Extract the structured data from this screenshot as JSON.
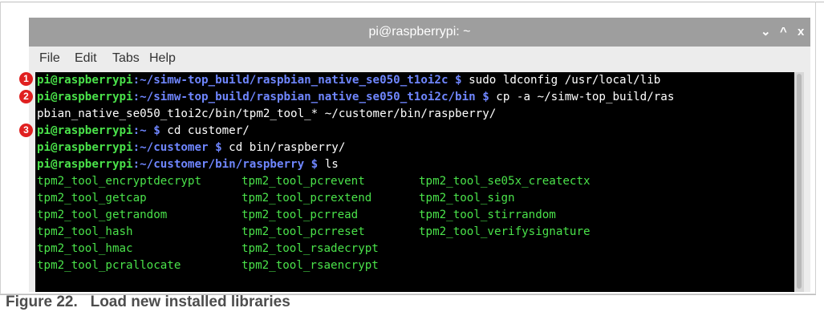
{
  "window": {
    "title": "pi@raspberrypi: ~",
    "minimize_glyph": "⌄",
    "maximize_glyph": "^",
    "close_glyph": "x"
  },
  "menu": {
    "items": [
      "File",
      "Edit",
      "Tabs",
      "Help"
    ]
  },
  "terminal": {
    "lines": [
      {
        "user": "pi@raspberrypi",
        "path": ":~/simw-top_build/raspbian_native_se050_t1oi2c $",
        "cmd": " sudo ldconfig /usr/local/lib"
      },
      {
        "user": "pi@raspberrypi",
        "path": ":~/simw-top_build/raspbian_native_se050_t1oi2c/bin $",
        "cmd": " cp -a ~/simw-top_build/ras"
      },
      {
        "text": "pbian_native_se050_t1oi2c/bin/tpm2_tool_* ~/customer/bin/raspberry/"
      },
      {
        "user": "pi@raspberrypi",
        "path": ":~ $",
        "cmd": " cd customer/"
      },
      {
        "user": "pi@raspberrypi",
        "path": ":~/customer $",
        "cmd": " cd bin/raspberry/"
      },
      {
        "user": "pi@raspberrypi",
        "path": ":~/customer/bin/raspberry $",
        "cmd": " ls"
      }
    ],
    "listing": [
      [
        "tpm2_tool_encryptdecrypt",
        "tpm2_tool_pcrevent",
        "tpm2_tool_se05x_createctx"
      ],
      [
        "tpm2_tool_getcap",
        "tpm2_tool_pcrextend",
        "tpm2_tool_sign"
      ],
      [
        "tpm2_tool_getrandom",
        "tpm2_tool_pcrread",
        "tpm2_tool_stirrandom"
      ],
      [
        "tpm2_tool_hash",
        "tpm2_tool_pcrreset",
        "tpm2_tool_verifysignature"
      ],
      [
        "tpm2_tool_hmac",
        "tpm2_tool_rsadecrypt",
        ""
      ],
      [
        "tpm2_tool_pcrallocate",
        "tpm2_tool_rsaencrypt",
        ""
      ]
    ]
  },
  "callouts": [
    "1",
    "2",
    "3"
  ],
  "caption": {
    "number": "Figure 22.",
    "text": "Load new installed libraries"
  },
  "colors": {
    "prompt_user": "#4ae24a",
    "prompt_path": "#6f86ff",
    "listing": "#4ae24a",
    "callout": "#e02020"
  }
}
